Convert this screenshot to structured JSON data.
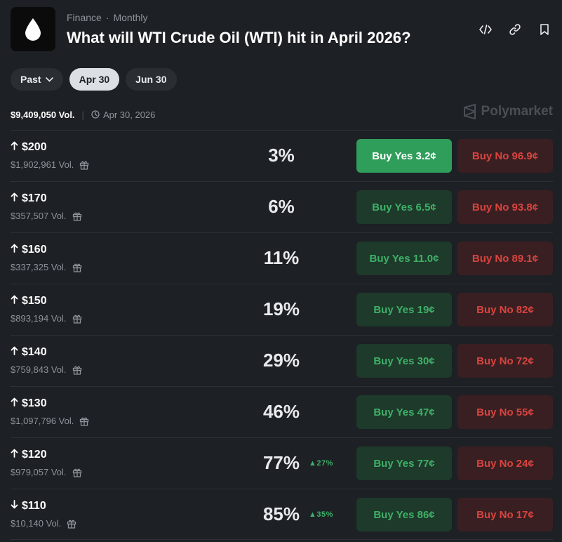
{
  "header": {
    "category": "Finance",
    "frequency": "Monthly",
    "title": "What will WTI Crude Oil (WTI) hit in April 2026?",
    "icons": [
      "code-embed-icon",
      "link-icon",
      "bookmark-icon"
    ]
  },
  "tabs": [
    {
      "label": "Past",
      "active": false
    },
    {
      "label": "Apr 30",
      "active": true
    },
    {
      "label": "Jun 30",
      "active": false
    }
  ],
  "meta": {
    "volume": "$9,409,050 Vol.",
    "date": "Apr 30, 2026",
    "brand": "Polymarket"
  },
  "colors": {
    "yes": "#3fb068",
    "yes_highlight": "#2f9e5a",
    "no": "#d9443f"
  },
  "markets": [
    {
      "label": "$200",
      "direction": "up",
      "volume": "$1,902,961 Vol.",
      "pct": "3%",
      "change": "",
      "yes": "Buy Yes 3.2¢",
      "no": "Buy No 96.9¢"
    },
    {
      "label": "$170",
      "direction": "up",
      "volume": "$357,507 Vol.",
      "pct": "6%",
      "change": "",
      "yes": "Buy Yes 6.5¢",
      "no": "Buy No 93.8¢"
    },
    {
      "label": "$160",
      "direction": "up",
      "volume": "$337,325 Vol.",
      "pct": "11%",
      "change": "",
      "yes": "Buy Yes 11.0¢",
      "no": "Buy No 89.1¢"
    },
    {
      "label": "$150",
      "direction": "up",
      "volume": "$893,194 Vol.",
      "pct": "19%",
      "change": "",
      "yes": "Buy Yes 19¢",
      "no": "Buy No 82¢"
    },
    {
      "label": "$140",
      "direction": "up",
      "volume": "$759,843 Vol.",
      "pct": "29%",
      "change": "",
      "yes": "Buy Yes 30¢",
      "no": "Buy No 72¢"
    },
    {
      "label": "$130",
      "direction": "up",
      "volume": "$1,097,796 Vol.",
      "pct": "46%",
      "change": "",
      "yes": "Buy Yes 47¢",
      "no": "Buy No 55¢"
    },
    {
      "label": "$120",
      "direction": "up",
      "volume": "$979,057 Vol.",
      "pct": "77%",
      "change": "▲27%",
      "yes": "Buy Yes 77¢",
      "no": "Buy No 24¢"
    },
    {
      "label": "$110",
      "direction": "down",
      "volume": "$10,140 Vol.",
      "pct": "85%",
      "change": "▲35%",
      "yes": "Buy Yes 86¢",
      "no": "Buy No 17¢"
    }
  ]
}
